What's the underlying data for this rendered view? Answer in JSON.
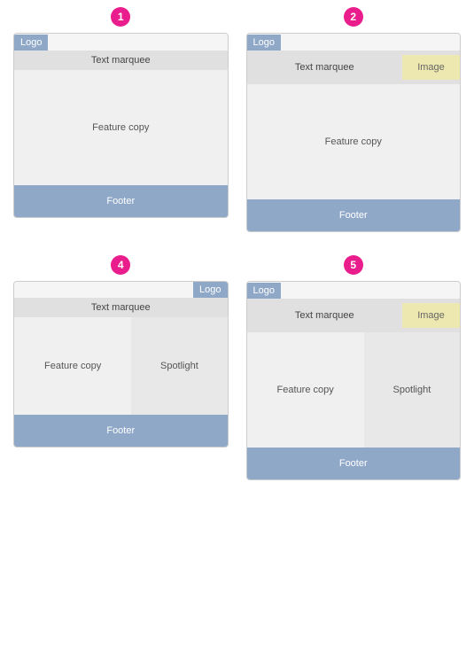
{
  "templates": [
    {
      "id": 1,
      "badge": "1",
      "logo": "Logo",
      "logo_align": "left",
      "marquee": "Text marquee",
      "has_image": false,
      "image_label": "",
      "feature": "Feature copy",
      "split": false,
      "spotlight": "",
      "footer": "Footer"
    },
    {
      "id": 2,
      "badge": "2",
      "logo": "Logo",
      "logo_align": "left",
      "marquee": "Text marquee",
      "has_image": true,
      "image_label": "Image",
      "feature": "Feature copy",
      "split": false,
      "spotlight": "",
      "footer": "Footer"
    },
    {
      "id": 4,
      "badge": "4",
      "logo": "Logo",
      "logo_align": "right",
      "marquee": "Text marquee",
      "has_image": false,
      "image_label": "",
      "feature": "Feature copy",
      "split": true,
      "spotlight": "Spotlight",
      "footer": "Footer"
    },
    {
      "id": 5,
      "badge": "5",
      "logo": "Logo",
      "logo_align": "left",
      "marquee": "Text marquee",
      "has_image": true,
      "image_label": "Image",
      "feature": "Feature copy",
      "split": true,
      "spotlight": "Spotlight",
      "footer": "Footer"
    }
  ],
  "colors": {
    "badge_bg": "#e91e8c",
    "logo_bg": "#8fa8c8",
    "marquee_bg": "#e0e0e0",
    "image_bg": "#ede8b0",
    "feature_bg": "#f0f0f0",
    "spotlight_bg": "#e8e8e8",
    "footer_bg": "#8fa8c8",
    "border": "#cccccc"
  }
}
